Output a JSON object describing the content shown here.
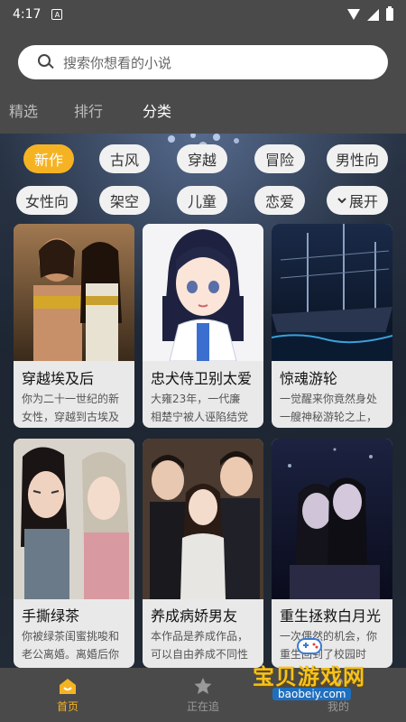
{
  "status_bar": {
    "time": "4:17",
    "notification": "A"
  },
  "search": {
    "placeholder": "搜索你想看的小说"
  },
  "tabs": [
    {
      "label": "精选"
    },
    {
      "label": "排行"
    },
    {
      "label": "分类"
    }
  ],
  "active_tab": "分类",
  "categories": [
    {
      "label": "新作",
      "selected": true
    },
    {
      "label": "古风"
    },
    {
      "label": "穿越"
    },
    {
      "label": "冒险"
    },
    {
      "label": "男性向"
    },
    {
      "label": "女性向"
    },
    {
      "label": "架空"
    },
    {
      "label": "儿童"
    },
    {
      "label": "恋爱"
    },
    {
      "label": "展开",
      "icon": "chevron-down-icon"
    }
  ],
  "books": [
    {
      "title": "穿越埃及后",
      "desc1": "你为二十一世纪的新",
      "desc2": "女性，穿越到古埃及"
    },
    {
      "title": "忠犬侍卫别太爱",
      "desc1": "大雍23年，一代廉",
      "desc2": "相楚宁被人诬陷结党"
    },
    {
      "title": "惊魂游轮",
      "desc1": "一觉醒来你竟然身处",
      "desc2": "一艘神秘游轮之上，"
    },
    {
      "title": "手撕绿茶",
      "desc1": "你被绿茶闺蜜挑唆和",
      "desc2": "老公离婚。离婚后你"
    },
    {
      "title": "养成病娇男友",
      "desc1": "本作品是养成作品，",
      "desc2": "可以自由养成不同性"
    },
    {
      "title": "重生拯救白月光",
      "desc1": "一次偶然的机会，你",
      "desc2": "重生回到了校园时"
    }
  ],
  "bottom_nav": [
    {
      "label": "首页",
      "icon": "home-icon",
      "active": true
    },
    {
      "label": "正在追",
      "icon": "star-icon"
    },
    {
      "label": "我的",
      "icon": "user-icon"
    }
  ],
  "watermark": {
    "brand": "宝贝游戏网",
    "url": "baobeiy.com"
  },
  "colors": {
    "accent": "#f5b324",
    "bar": "#4a4a4a",
    "chip": "#f1f1f1"
  }
}
